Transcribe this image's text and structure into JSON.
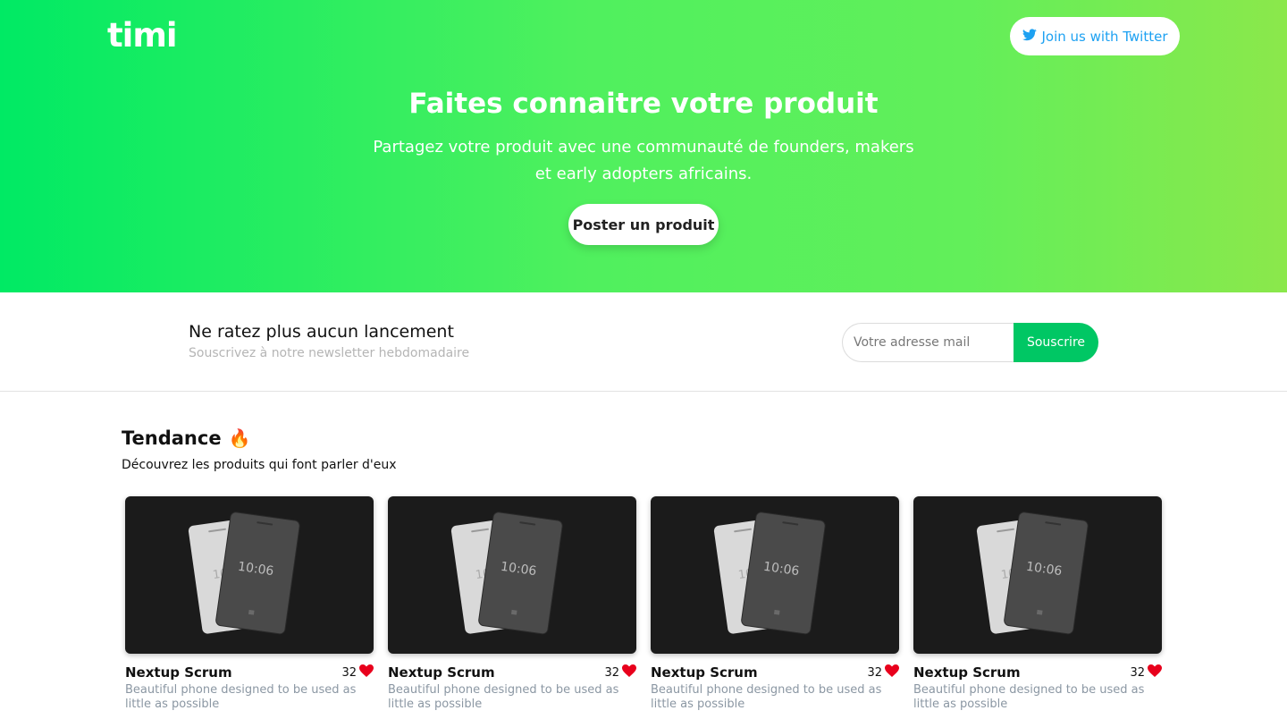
{
  "brand": {
    "logo": "timi"
  },
  "header": {
    "twitter_label": "Join us with Twitter"
  },
  "hero": {
    "title": "Faites connaitre votre produit",
    "subtitle": "Partagez votre produit avec une communauté de founders, makers et early adopters africains.",
    "cta": "Poster un produit"
  },
  "newsletter": {
    "title": "Ne ratez plus aucun lancement",
    "subtitle": "Souscrivez à notre newsletter hebdomadaire",
    "placeholder": "Votre adresse mail",
    "button": "Souscrire"
  },
  "trending": {
    "title": "Tendance",
    "emoji": "🔥",
    "subtitle": "Découvrez les produits qui font parler d'eux",
    "products": [
      {
        "name": "Nextup Scrum",
        "likes": "32",
        "description": "Beautiful phone designed to be used as little as possible",
        "screen_time": "10:06"
      },
      {
        "name": "Nextup Scrum",
        "likes": "32",
        "description": "Beautiful phone designed to be used as little as possible",
        "screen_time": "10:06"
      },
      {
        "name": "Nextup Scrum",
        "likes": "32",
        "description": "Beautiful phone designed to be used as little as possible",
        "screen_time": "10:06"
      },
      {
        "name": "Nextup Scrum",
        "likes": "32",
        "description": "Beautiful phone designed to be used as little as possible",
        "screen_time": "10:06"
      }
    ]
  },
  "colors": {
    "accent_green": "#00c764",
    "twitter_blue": "#1da1f2",
    "heart_red": "#e8001c"
  },
  "icons": {
    "twitter": "twitter-bird-icon",
    "heart": "heart-icon",
    "fire": "fire-emoji"
  }
}
